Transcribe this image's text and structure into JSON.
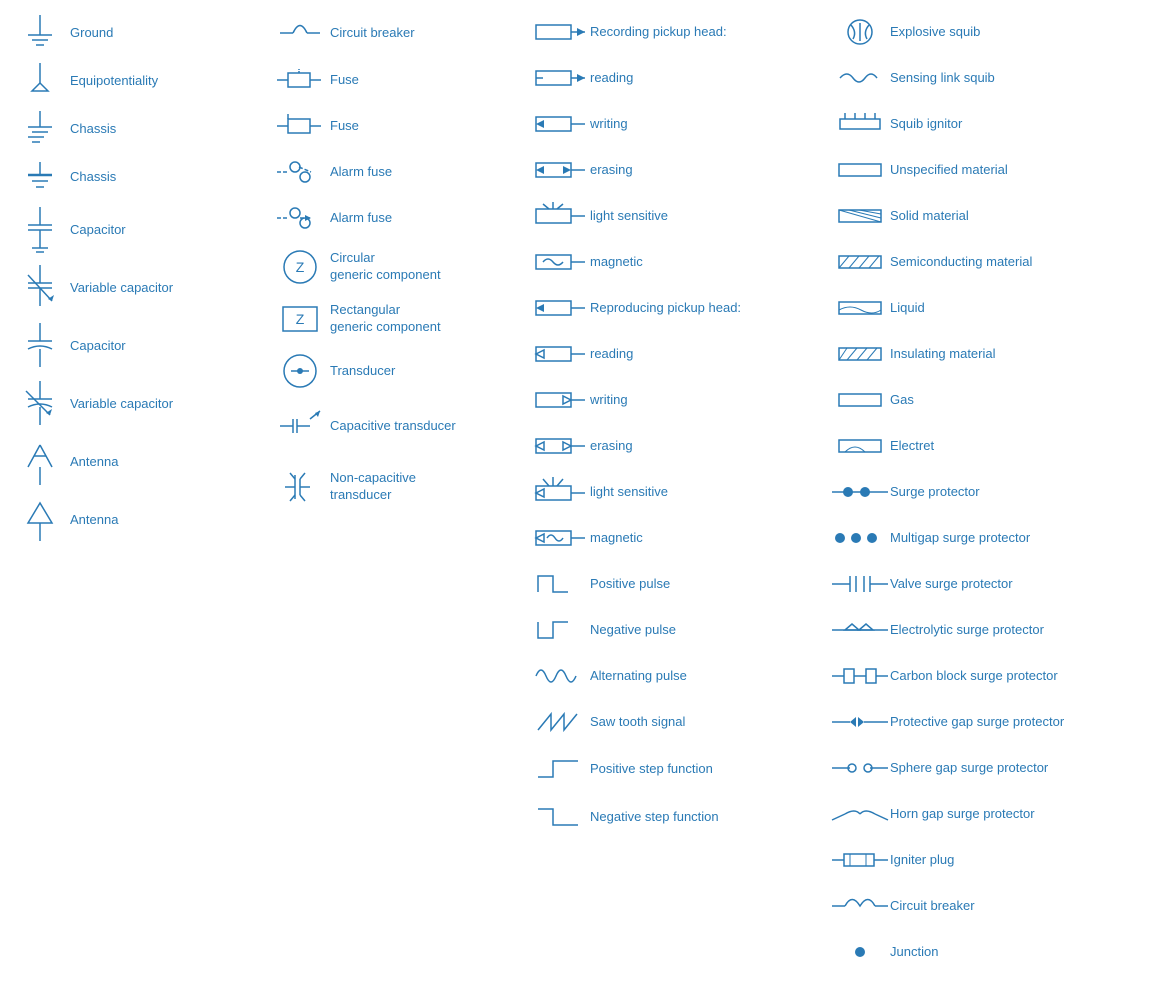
{
  "columns": [
    {
      "items": [
        {
          "id": "ground",
          "label": "Ground"
        },
        {
          "id": "equipotentiality",
          "label": "Equipotentiality"
        },
        {
          "id": "chassis1",
          "label": "Chassis"
        },
        {
          "id": "chassis2",
          "label": "Chassis"
        },
        {
          "id": "capacitor1",
          "label": "Capacitor"
        },
        {
          "id": "variable-capacitor1",
          "label": "Variable capacitor"
        },
        {
          "id": "capacitor2",
          "label": "Capacitor"
        },
        {
          "id": "variable-capacitor2",
          "label": "Variable capacitor"
        },
        {
          "id": "antenna1",
          "label": "Antenna"
        },
        {
          "id": "antenna2",
          "label": "Antenna"
        }
      ]
    },
    {
      "items": [
        {
          "id": "circuit-breaker",
          "label": "Circuit breaker"
        },
        {
          "id": "fuse1",
          "label": "Fuse"
        },
        {
          "id": "fuse2",
          "label": "Fuse"
        },
        {
          "id": "alarm-fuse1",
          "label": "Alarm fuse"
        },
        {
          "id": "alarm-fuse2",
          "label": "Alarm fuse"
        },
        {
          "id": "circular-generic",
          "label": "Circular\ngeneric component"
        },
        {
          "id": "rectangular-generic",
          "label": "Rectangular\ngeneric component"
        },
        {
          "id": "transducer",
          "label": "Transducer"
        },
        {
          "id": "capacitive-transducer",
          "label": "Capacitive transducer"
        },
        {
          "id": "non-capacitive-transducer",
          "label": "Non-capacitive\ntransducer"
        }
      ]
    },
    {
      "items": [
        {
          "id": "rec-pickup-head",
          "label": "Recording pickup head:"
        },
        {
          "id": "reading1",
          "label": "reading"
        },
        {
          "id": "writing1",
          "label": "writing"
        },
        {
          "id": "erasing1",
          "label": "erasing"
        },
        {
          "id": "light-sensitive1",
          "label": "light sensitive"
        },
        {
          "id": "magnetic1",
          "label": "magnetic"
        },
        {
          "id": "rep-pickup-head",
          "label": "Reproducing pickup head:"
        },
        {
          "id": "reading2",
          "label": "reading"
        },
        {
          "id": "writing2",
          "label": "writing"
        },
        {
          "id": "erasing2",
          "label": "erasing"
        },
        {
          "id": "light-sensitive2",
          "label": "light sensitive"
        },
        {
          "id": "magnetic2",
          "label": "magnetic"
        },
        {
          "id": "positive-pulse",
          "label": "Positive pulse"
        },
        {
          "id": "negative-pulse",
          "label": "Negative pulse"
        },
        {
          "id": "alternating-pulse",
          "label": "Alternating pulse"
        },
        {
          "id": "saw-tooth",
          "label": "Saw tooth signal"
        },
        {
          "id": "positive-step",
          "label": "Positive step function"
        },
        {
          "id": "negative-step",
          "label": "Negative step function"
        }
      ]
    },
    {
      "items": [
        {
          "id": "explosive-squib",
          "label": "Explosive squib"
        },
        {
          "id": "sensing-link-squib",
          "label": "Sensing link squib"
        },
        {
          "id": "squib-ignitor",
          "label": "Squib ignitor"
        },
        {
          "id": "unspecified-material",
          "label": "Unspecified material"
        },
        {
          "id": "solid-material",
          "label": "Solid material"
        },
        {
          "id": "semiconducting-material",
          "label": "Semiconducting material"
        },
        {
          "id": "liquid",
          "label": "Liquid"
        },
        {
          "id": "insulating-material",
          "label": "Insulating material"
        },
        {
          "id": "gas",
          "label": "Gas"
        },
        {
          "id": "electret",
          "label": "Electret"
        },
        {
          "id": "surge-protector",
          "label": "Surge protector"
        },
        {
          "id": "multigap-surge-protector",
          "label": "Multigap surge protector"
        },
        {
          "id": "valve-surge-protector",
          "label": "Valve surge protector"
        },
        {
          "id": "electrolytic-surge-protector",
          "label": "Electrolytic surge protector"
        },
        {
          "id": "carbon-block-surge-protector",
          "label": "Carbon block surge protector"
        },
        {
          "id": "protective-gap-surge-protector",
          "label": "Protective gap surge protector"
        },
        {
          "id": "sphere-gap-surge-protector",
          "label": "Sphere gap surge protector"
        },
        {
          "id": "horn-gap-surge-protector",
          "label": "Horn gap surge protector"
        },
        {
          "id": "igniter-plug",
          "label": "Igniter plug"
        },
        {
          "id": "circuit-breaker2",
          "label": "Circuit breaker"
        },
        {
          "id": "junction",
          "label": "Junction"
        }
      ]
    }
  ]
}
